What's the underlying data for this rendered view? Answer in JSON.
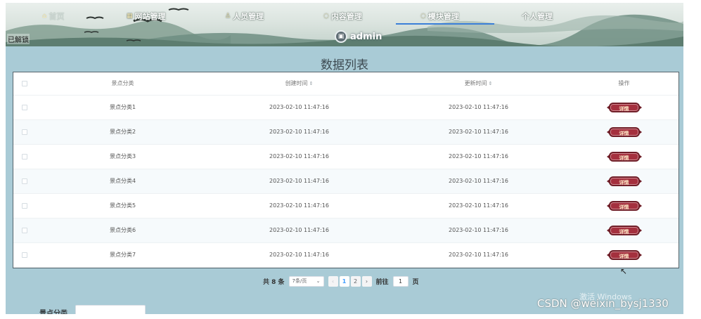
{
  "nav": {
    "items": [
      {
        "label": "首页",
        "icon": "home-icon"
      },
      {
        "label": "网站管理",
        "icon": "grid-icon"
      },
      {
        "label": "人员管理",
        "icon": "user-icon"
      },
      {
        "label": "内容管理",
        "icon": "content-icon"
      },
      {
        "label": "模块管理",
        "icon": "module-icon"
      },
      {
        "label": "个人管理",
        "icon": ""
      }
    ],
    "active_index": 4
  },
  "header": {
    "status_text": "已解锁",
    "username": "admin"
  },
  "main": {
    "title": "数据列表",
    "columns": {
      "category": "景点分类",
      "created": "创建时间",
      "updated": "更新时间",
      "actions": "操作"
    },
    "rows": [
      {
        "category": "景点分类1",
        "created": "2023-02-10 11:47:16",
        "updated": "2023-02-10 11:47:16",
        "action": "详情"
      },
      {
        "category": "景点分类2",
        "created": "2023-02-10 11:47:16",
        "updated": "2023-02-10 11:47:16",
        "action": "详情"
      },
      {
        "category": "景点分类3",
        "created": "2023-02-10 11:47:16",
        "updated": "2023-02-10 11:47:16",
        "action": "详情"
      },
      {
        "category": "景点分类4",
        "created": "2023-02-10 11:47:16",
        "updated": "2023-02-10 11:47:16",
        "action": "详情"
      },
      {
        "category": "景点分类5",
        "created": "2023-02-10 11:47:16",
        "updated": "2023-02-10 11:47:16",
        "action": "详情"
      },
      {
        "category": "景点分类6",
        "created": "2023-02-10 11:47:16",
        "updated": "2023-02-10 11:47:16",
        "action": "详情"
      },
      {
        "category": "景点分类7",
        "created": "2023-02-10 11:47:16",
        "updated": "2023-02-10 11:47:16",
        "action": "详情"
      }
    ]
  },
  "pagination": {
    "total": "共 8 条",
    "page_size": "7条/页",
    "pages": [
      "1",
      "2"
    ],
    "current_page": "1",
    "goto_label": "前往",
    "goto_value": "1",
    "page_suffix": "页"
  },
  "search": {
    "label": "景点分类"
  },
  "watermarks": {
    "activation": "激活 Windows",
    "csdn": "CSDN @weixin_bysj1330"
  },
  "colors": {
    "accent": "#3b7fd8",
    "detail_button": "#a4303e",
    "background": "#a9cbd6"
  }
}
